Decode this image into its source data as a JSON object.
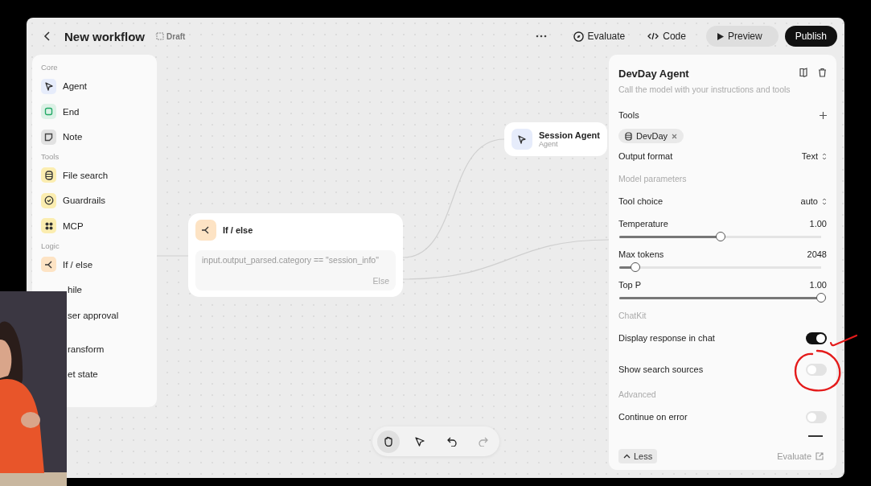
{
  "header": {
    "title": "New workflow",
    "badge": "Draft",
    "actions": [
      {
        "kind": "more"
      },
      {
        "kind": "evaluate",
        "label": "Evaluate"
      },
      {
        "kind": "code",
        "label": "Code"
      },
      {
        "kind": "preview",
        "label": "Preview"
      },
      {
        "kind": "publish",
        "label": "Publish"
      }
    ]
  },
  "sidebar": {
    "sections": [
      {
        "title": "Core",
        "items": [
          {
            "kind": "agent",
            "label": "Agent",
            "color": "#e6ecfb"
          },
          {
            "kind": "end",
            "label": "End",
            "color": "#dcf1e6"
          },
          {
            "kind": "note",
            "label": "Note",
            "color": "#e2e2e2"
          }
        ]
      },
      {
        "title": "Tools",
        "items": [
          {
            "kind": "database",
            "label": "File search",
            "color": "#fbedb0"
          },
          {
            "kind": "shield",
            "label": "Guardrails",
            "color": "#fbedb0"
          },
          {
            "kind": "mcp",
            "label": "MCP",
            "color": "#fbedb0"
          }
        ]
      },
      {
        "title": "Logic",
        "items": [
          {
            "kind": "branch",
            "label": "If / else",
            "color": "#fde3c4"
          },
          {
            "kind": "covered",
            "label": "hile"
          },
          {
            "kind": "covered",
            "label": "ser approval"
          }
        ]
      },
      {
        "items": [
          {
            "kind": "covered",
            "label": "ransform"
          },
          {
            "kind": "covered",
            "label": "et state"
          }
        ]
      }
    ]
  },
  "canvas": {
    "nodes": [
      {
        "kind": "agent",
        "title": "Session Agent",
        "subtitle": "Agent"
      },
      {
        "kind": "condition",
        "title": "If / else",
        "condition": "input.output_parsed.category == \"session_info\"",
        "else": "Else"
      }
    ],
    "toolbar": [
      {
        "kind": "hand",
        "selected": true,
        "disabled": false
      },
      {
        "kind": "pointer",
        "selected": false,
        "disabled": false
      },
      {
        "kind": "undo",
        "selected": false,
        "disabled": false
      },
      {
        "kind": "redo",
        "selected": false,
        "disabled": true
      }
    ]
  },
  "panel": {
    "title": "DevDay Agent",
    "subtitle": "Call the model with your instructions and tools",
    "rows": [
      {
        "kind": "tools",
        "label": "Tools",
        "chip": "DevDay"
      },
      {
        "kind": "select",
        "label": "Output format",
        "value": "Text"
      },
      {
        "kind": "section",
        "label": "Model parameters"
      },
      {
        "kind": "select",
        "label": "Tool choice",
        "value": "auto"
      },
      {
        "kind": "slider",
        "label": "Temperature",
        "reading": "1.00",
        "level": 0.5
      },
      {
        "kind": "slider",
        "label": "Max tokens",
        "reading": "2048",
        "level": 0.08
      },
      {
        "kind": "slider",
        "label": "Top P",
        "reading": "1.00",
        "level": 1
      },
      {
        "kind": "section",
        "label": "ChatKit"
      },
      {
        "kind": "toggle",
        "label": "Display response in chat",
        "on": true
      },
      {
        "kind": "toggle",
        "label": "Show search sources",
        "on": false
      },
      {
        "kind": "section",
        "label": "Advanced"
      },
      {
        "kind": "toggle",
        "label": "Continue on error",
        "on": false
      }
    ],
    "less": "Less",
    "evaluate": "Evaluate"
  },
  "annotations": [
    {
      "kind": "stroke"
    },
    {
      "kind": "circle"
    }
  ]
}
